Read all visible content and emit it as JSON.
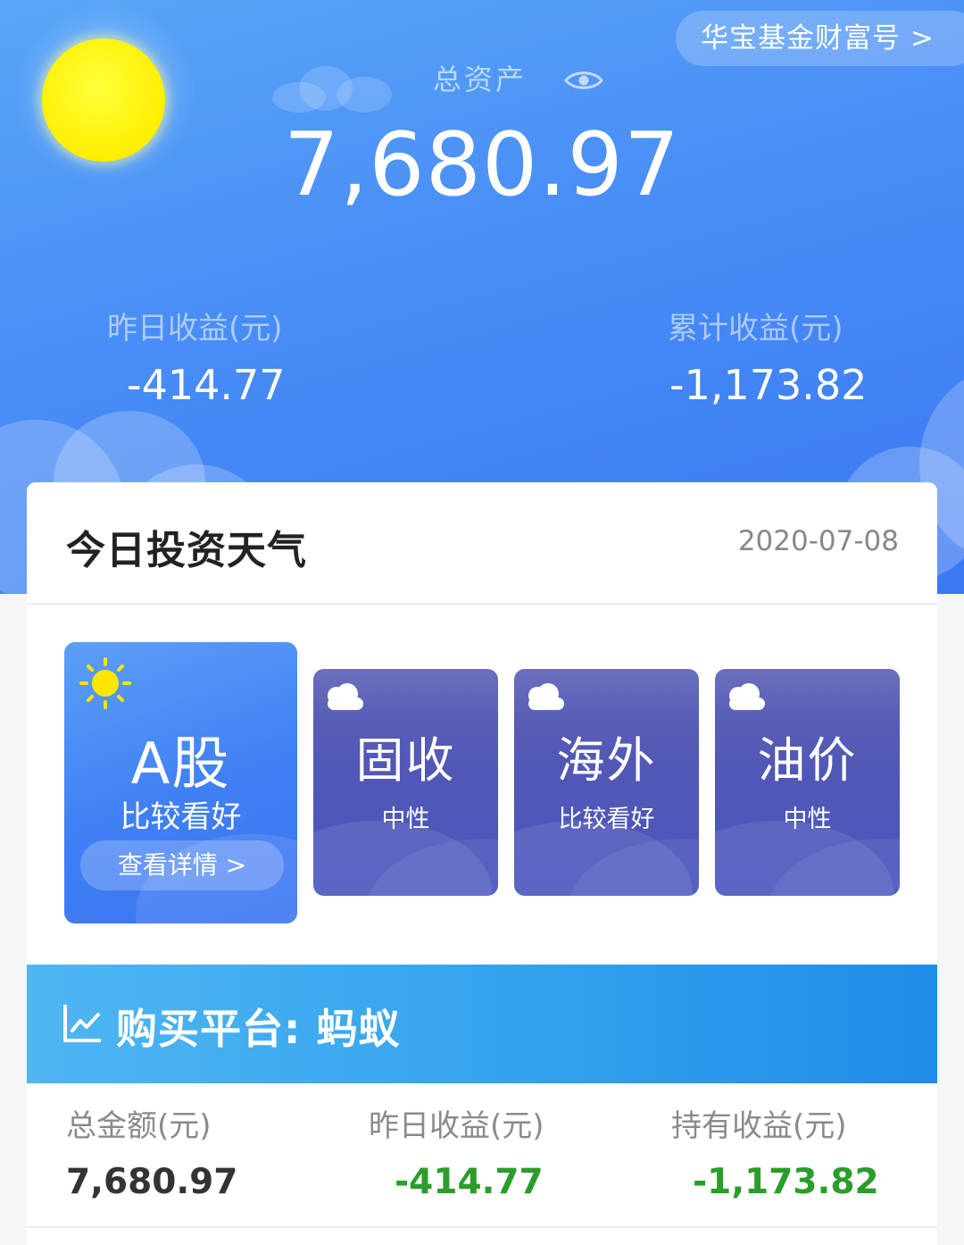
{
  "header": {
    "brand_link": "华宝基金财富号 >",
    "total_assets_label": "总资产",
    "total_assets_value": "7,680.97",
    "yesterday_label": "昨日收益(元)",
    "yesterday_value": "-414.77",
    "cumulative_label": "累计收益(元)",
    "cumulative_value": "-1,173.82",
    "eye_icon": "eye-icon",
    "weather_icon": "sun-icon"
  },
  "weather": {
    "title": "今日投资天气",
    "date": "2020-07-08",
    "tiles": [
      {
        "name": "A股",
        "status": "比较看好",
        "link": "查看详情 >",
        "icon": "sun-icon"
      },
      {
        "name": "固收",
        "status": "中性",
        "icon": "cloud-icon"
      },
      {
        "name": "海外",
        "status": "比较看好",
        "icon": "cloud-icon"
      },
      {
        "name": "油价",
        "status": "中性",
        "icon": "cloud-icon"
      }
    ]
  },
  "platform": {
    "title": "购买平台: 蚂蚁",
    "icon": "line-chart-icon"
  },
  "summary": {
    "total_label": "总金额(元)",
    "total_value": "7,680.97",
    "yesterday_label": "昨日收益(元)",
    "yesterday_value": "-414.77",
    "holding_label": "持有收益(元)",
    "holding_value": "-1,173.82"
  },
  "colors": {
    "hero_blue": "#4a8ff6",
    "sun_yellow": "#ffef00",
    "tile_blue": "#3f7ff4",
    "tile_purple": "#5157b5",
    "banner_blue": "#35a4ee",
    "loss_green": "#2a9d2a"
  }
}
